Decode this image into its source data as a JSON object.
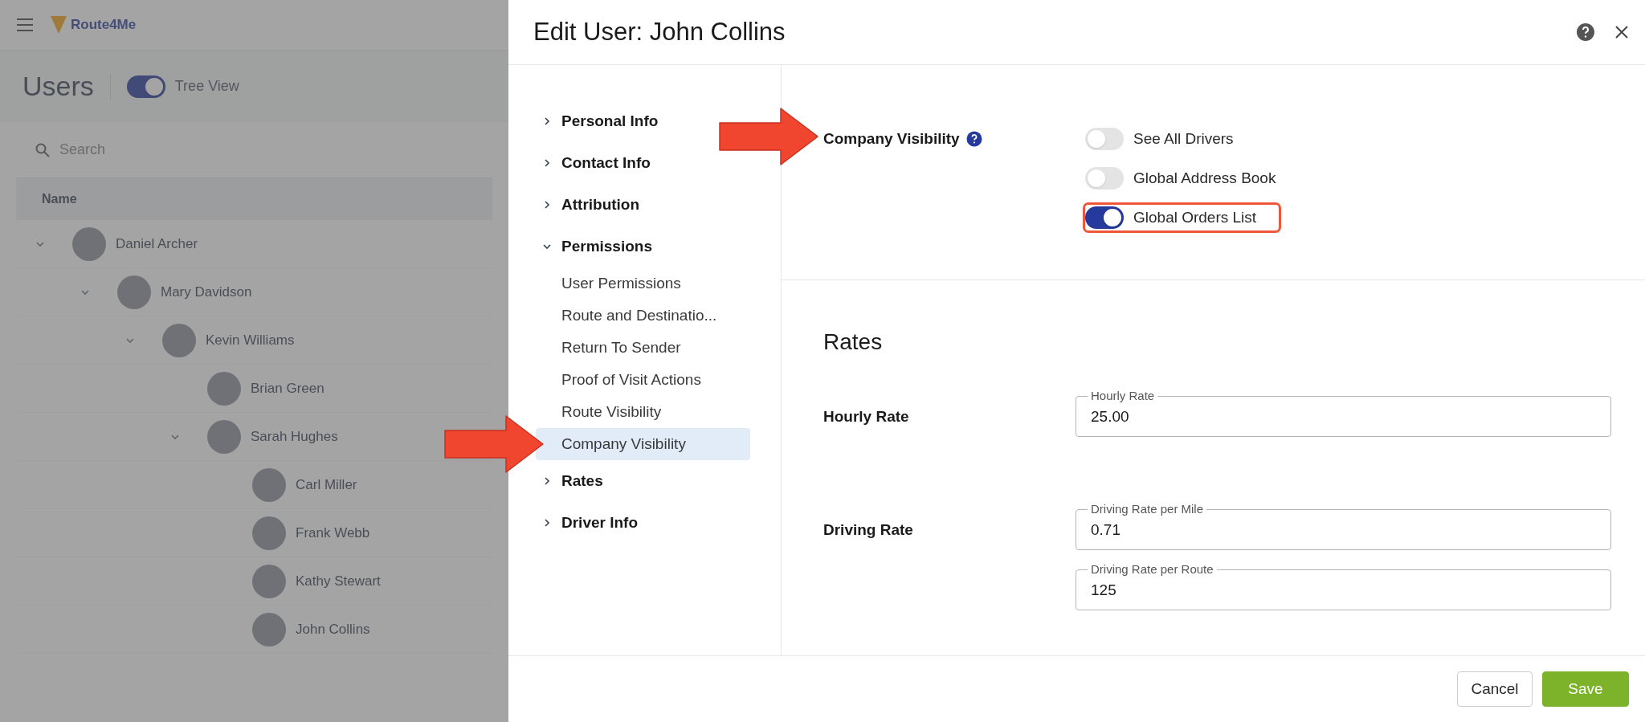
{
  "background": {
    "logo": "Route4Me",
    "page_title": "Users",
    "tree_view": {
      "label": "Tree View",
      "on": true
    },
    "search": {
      "placeholder": "Search"
    },
    "table": {
      "columns": [
        "Name"
      ],
      "rows": [
        {
          "name": "Daniel Archer",
          "expanded": true,
          "children": [
            {
              "name": "Mary Davidson",
              "expanded": true,
              "children": [
                {
                  "name": "Kevin Williams",
                  "expanded": true,
                  "children": [
                    {
                      "name": "Brian Green",
                      "expanded": false
                    },
                    {
                      "name": "Sarah Hughes",
                      "expanded": true,
                      "children": [
                        {
                          "name": "Carl Miller",
                          "expanded": false
                        },
                        {
                          "name": "Frank Webb",
                          "expanded": false
                        },
                        {
                          "name": "Kathy Stewart",
                          "expanded": false
                        },
                        {
                          "name": "John Collins",
                          "expanded": false
                        }
                      ]
                    }
                  ]
                }
              ]
            }
          ]
        }
      ]
    }
  },
  "dialog": {
    "title": "Edit User: John Collins",
    "nav": [
      {
        "label": "Personal Info",
        "expanded": false
      },
      {
        "label": "Contact Info",
        "expanded": false
      },
      {
        "label": "Attribution",
        "expanded": false
      },
      {
        "label": "Permissions",
        "expanded": true,
        "children": [
          {
            "label": "User Permissions",
            "selected": false
          },
          {
            "label": "Route and Destinatio...",
            "selected": false
          },
          {
            "label": "Return To Sender",
            "selected": false
          },
          {
            "label": "Proof of Visit Actions",
            "selected": false
          },
          {
            "label": "Route Visibility",
            "selected": false
          },
          {
            "label": "Company Visibility",
            "selected": true
          }
        ]
      },
      {
        "label": "Rates",
        "expanded": false
      },
      {
        "label": "Driver Info",
        "expanded": false
      }
    ],
    "company_visibility": {
      "label": "Company Visibility",
      "toggles": [
        {
          "label": "See All Drivers",
          "on": false,
          "highlighted": false
        },
        {
          "label": "Global Address Book",
          "on": false,
          "highlighted": false
        },
        {
          "label": "Global Orders List",
          "on": true,
          "highlighted": true
        }
      ]
    },
    "rates": {
      "heading": "Rates",
      "groups": [
        {
          "label": "Hourly Rate",
          "fields": [
            {
              "label": "Hourly Rate",
              "value": "25.00"
            }
          ]
        },
        {
          "label": "Driving Rate",
          "fields": [
            {
              "label": "Driving Rate per Mile",
              "value": "0.71"
            },
            {
              "label": "Driving Rate per Route",
              "value": "125"
            }
          ]
        }
      ]
    },
    "buttons": [
      {
        "label": "Cancel",
        "kind": "secondary"
      },
      {
        "label": "Save",
        "kind": "primary"
      }
    ]
  },
  "annotations": [
    {
      "kind": "arrow"
    },
    {
      "kind": "arrow"
    }
  ]
}
